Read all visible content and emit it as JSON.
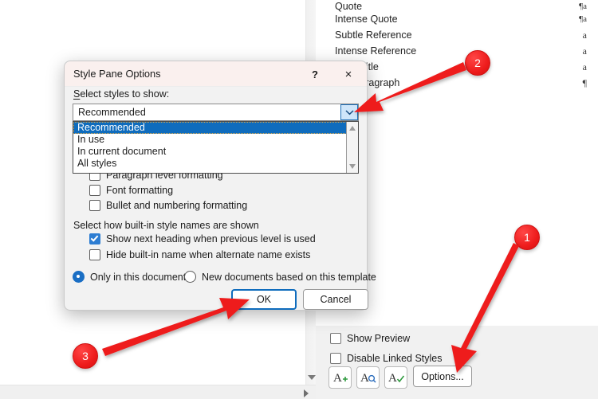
{
  "styles_pane": {
    "items": [
      {
        "name": "Quote",
        "mark": "¶a"
      },
      {
        "name": "Intense Quote",
        "mark": "¶a"
      },
      {
        "name": "Subtle Reference",
        "mark": "a"
      },
      {
        "name": "Intense Reference",
        "mark": "a"
      },
      {
        "name": "Book Title",
        "mark": "a"
      },
      {
        "name": "List Paragraph",
        "mark": "¶"
      }
    ],
    "show_preview_label": "Show Preview",
    "disable_linked_label": "Disable Linked Styles",
    "new_style_icon": "new-style-icon",
    "inspector_icon": "style-inspector-icon",
    "manage_icon": "manage-styles-icon",
    "options_label": "Options..."
  },
  "dialog": {
    "title": "Style Pane Options",
    "help_glyph": "?",
    "close_glyph": "×",
    "select_styles_label": "Select styles to show:",
    "combo_value": "Recommended",
    "dropdown_options": [
      "Recommended",
      "In use",
      "In current document",
      "All styles"
    ],
    "dropdown_selected": "Recommended",
    "checkboxes_formatting": [
      {
        "label": "Paragraph level formatting",
        "checked": false
      },
      {
        "label": "Font formatting",
        "checked": false
      },
      {
        "label": "Bullet and numbering formatting",
        "checked": false
      }
    ],
    "builtin_section_label": "Select how built-in style names are shown",
    "checkboxes_builtin": [
      {
        "label": "Show next heading when previous level is used",
        "checked": true
      },
      {
        "label": "Hide built-in name when alternate name exists",
        "checked": false
      }
    ],
    "radios": [
      {
        "label": "Only in this document",
        "checked": true
      },
      {
        "label": "New documents based on this template",
        "checked": false
      }
    ],
    "ok_label": "OK",
    "cancel_label": "Cancel"
  },
  "annotations": {
    "markers": [
      {
        "label": "1"
      },
      {
        "label": "2"
      },
      {
        "label": "3"
      }
    ],
    "accent_color": "#ee1c1c"
  }
}
